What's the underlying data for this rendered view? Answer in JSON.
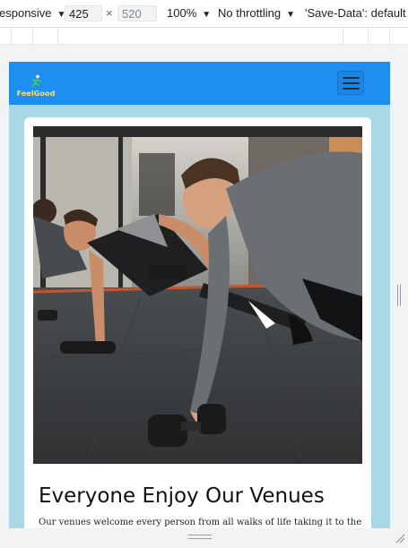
{
  "devtools": {
    "device_label": "esponsive",
    "width_value": "425",
    "times_symbol": "×",
    "height_placeholder": "520",
    "zoom": "100%",
    "throttle": "No throttling",
    "save_data": "'Save-Data': default"
  },
  "site": {
    "logo_text": "FeelGood",
    "nav_bg": "#1e8ff0",
    "page_bg": "#a9d7e6",
    "headline": "Everyone Enjoy Our Venues",
    "body_text": "Our venues welcome every person from all walks of life taking it to the next"
  }
}
